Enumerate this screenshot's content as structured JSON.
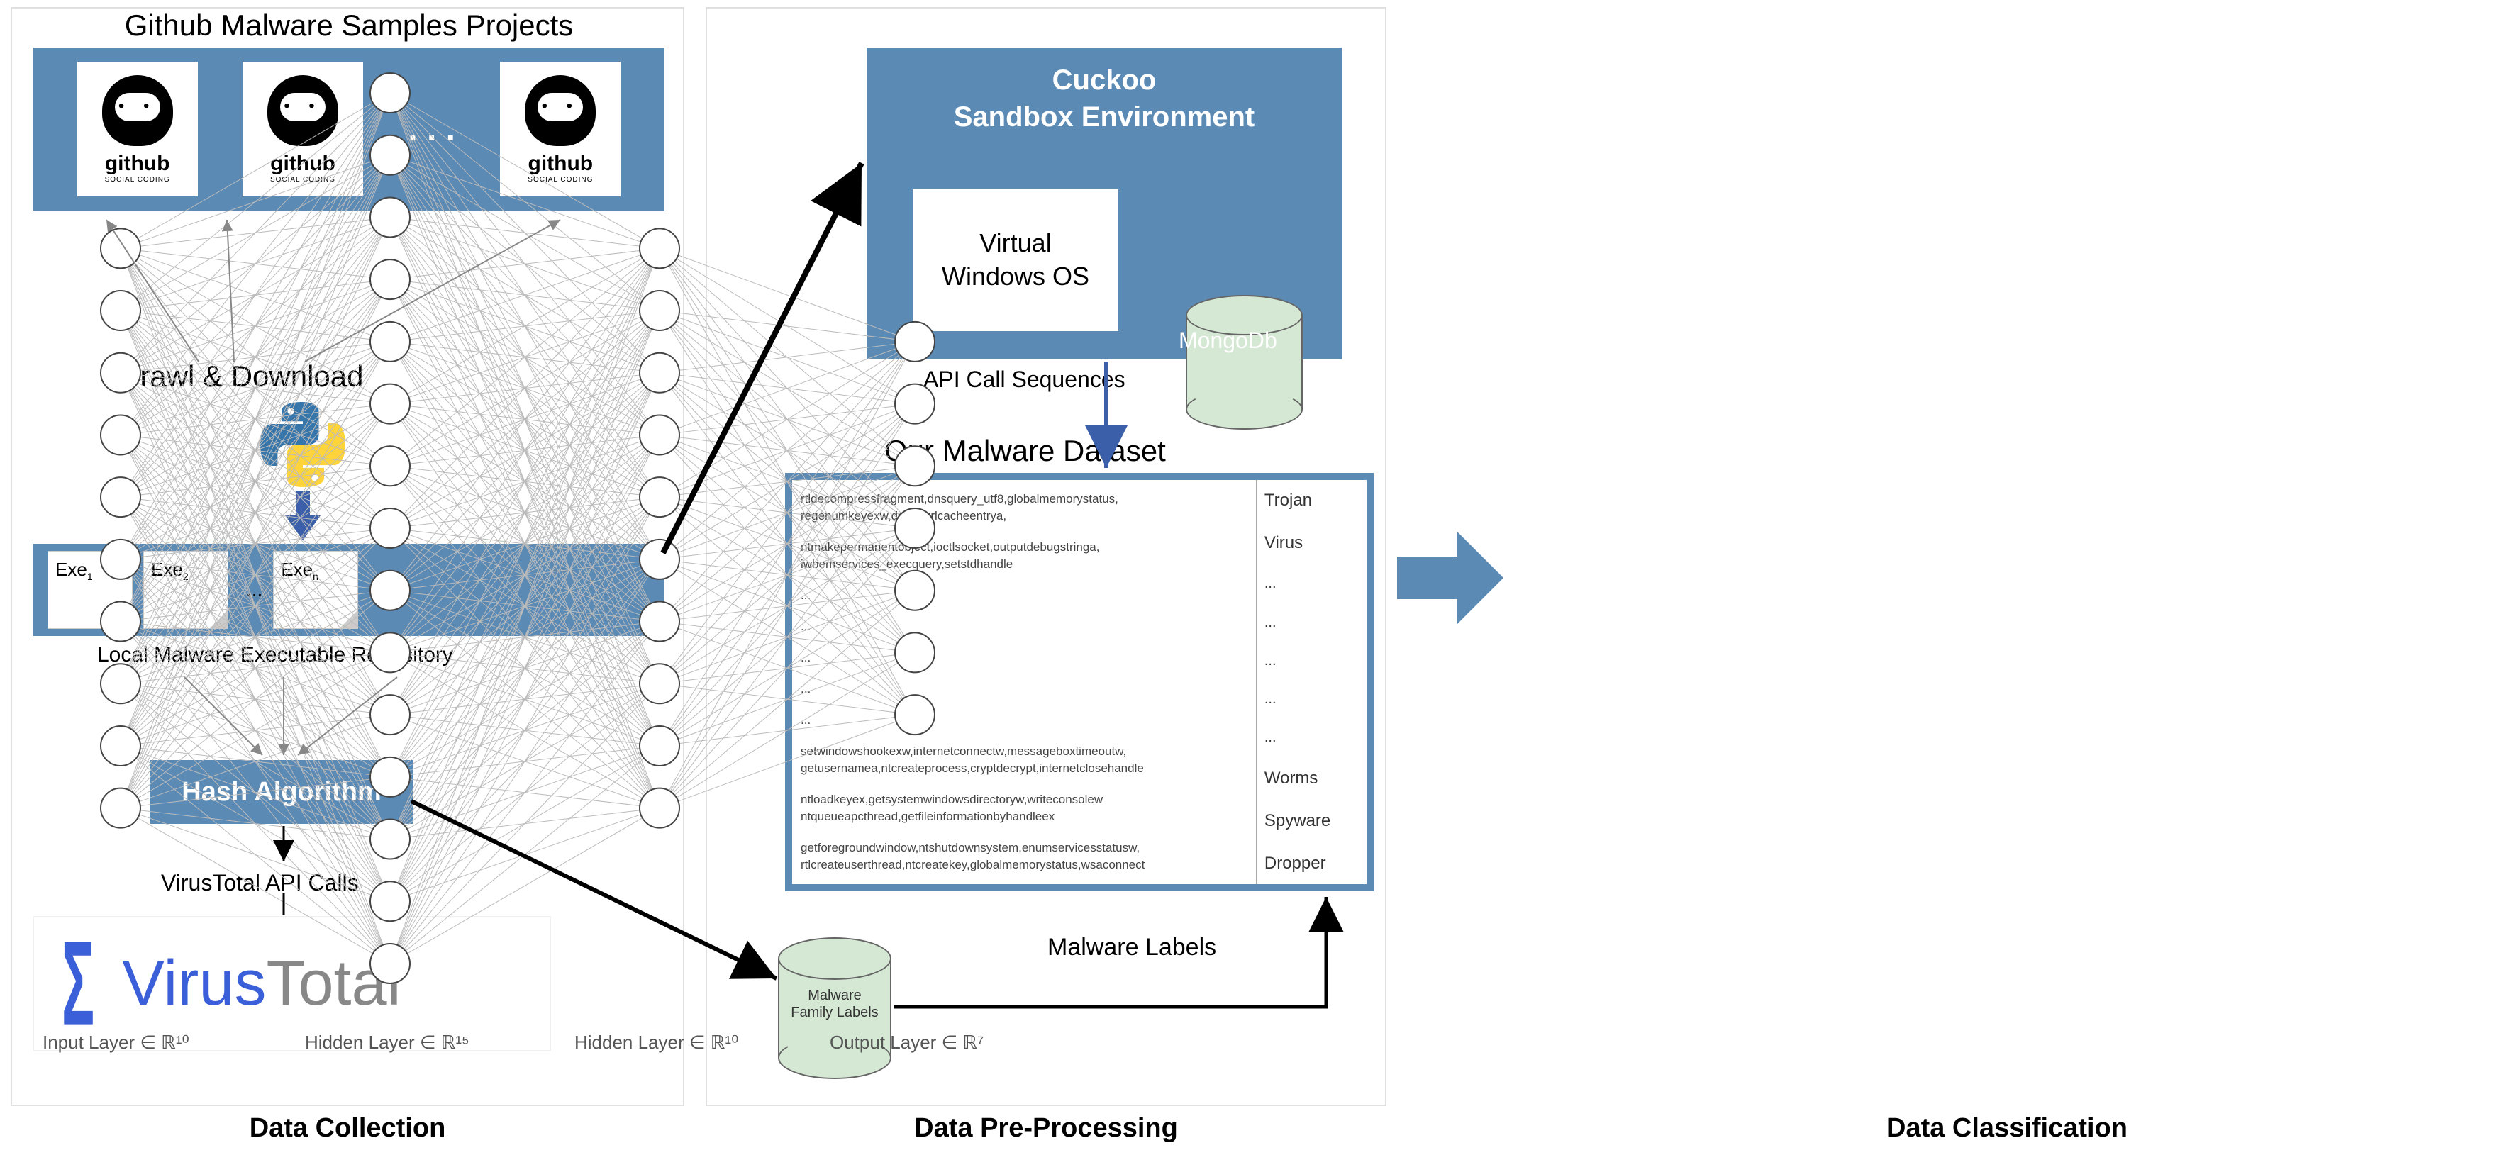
{
  "panels": {
    "collection": "Data Collection",
    "preprocessing": "Data Pre-Processing",
    "classification": "Data Classification"
  },
  "collection": {
    "github_title": "Github Malware Samples Projects",
    "github_tile_label": "github",
    "github_tile_sub": "SOCIAL CODING",
    "github_ellipsis": ". . .",
    "crawl_label": "Crawl & Download",
    "exe_labels": [
      "Exe",
      "Exe",
      "Exe"
    ],
    "exe_subs": [
      "1",
      "2",
      "n"
    ],
    "exe_ellipsis": "...",
    "local_repo": "Local Malware Executable Repository",
    "hash_box": "Hash Algorithm",
    "vt_api": "VirusTotal API Calls",
    "virustotal": "VirusTotal"
  },
  "preprocessing": {
    "cuckoo_title_l1": "Cuckoo",
    "cuckoo_title_l2": "Sandbox Environment",
    "vwin_l1": "Virtual",
    "vwin_l2": "Windows OS",
    "mongo": "MongoDb",
    "api_seq": "API Call Sequences",
    "dataset_title": "Our Malware Dataset",
    "dataset_left": [
      "rtldecompressfragment,dnsquery_utf8,globalmemorystatus, regenumkeyexw,deleteurlcacheentrya,",
      "ntmakepermanentobject,ioctlsocket,outputdebugstringa, iwbemservices_execquery,setstdhandle",
      "...",
      "...",
      "...",
      "...",
      "...",
      "setwindowshookexw,internetconnectw,messageboxtimeoutw, getusernamea,ntcreateprocess,cryptdecrypt,internetclosehandle",
      "ntloadkeyex,getsystemwindowsdirectoryw,writeconsolew ntqueueapcthread,getfileinformationbyhandleex",
      "getforegroundwindow,ntshutdownsystem,enumservicesstatusw, rtlcreateuserthread,ntcreatekey,globalmemorystatus,wsaconnect"
    ],
    "dataset_right": [
      "Trojan",
      "Virus",
      "...",
      "...",
      "...",
      "...",
      "...",
      "Worms",
      "Spyware",
      "Dropper"
    ],
    "mfl_label": "Malware Family Labels",
    "malware_labels_text": "Malware Labels"
  },
  "classification": {
    "layers": [
      {
        "label": "Input Layer ∈ ℝ¹⁰",
        "nodes": 10
      },
      {
        "label": "Hidden Layer ∈ ℝ¹⁵",
        "nodes": 15
      },
      {
        "label": "Hidden Layer ∈ ℝ¹⁰",
        "nodes": 10
      },
      {
        "label": "Output Layer ∈ ℝ⁷",
        "nodes": 7
      }
    ]
  }
}
